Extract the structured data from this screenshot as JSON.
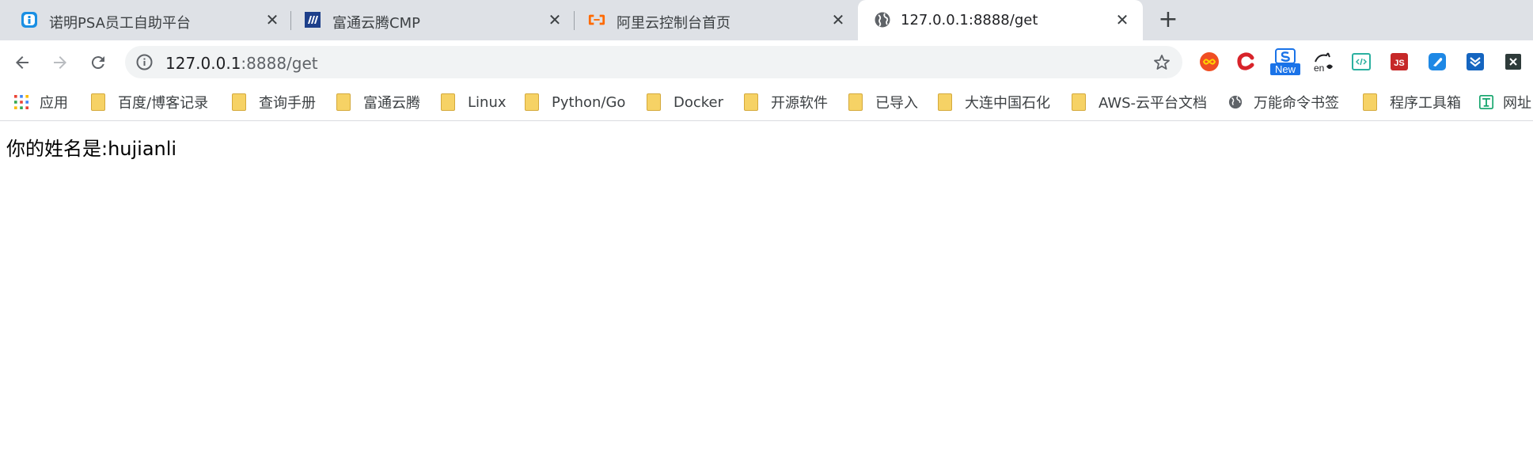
{
  "tabs": [
    {
      "title": "诺明PSA员工自助平台",
      "close": "✕"
    },
    {
      "title": "富通云腾CMP",
      "close": "✕"
    },
    {
      "title": "阿里云控制台首页",
      "close": "✕"
    },
    {
      "title": "127.0.0.1:8888/get",
      "close": "✕"
    }
  ],
  "new_tab": "+",
  "address": {
    "host": "127.0.0.1",
    "rest": ":8888/get"
  },
  "extensions": {
    "new_badge": "New",
    "js_label": "JS",
    "en_label": "en"
  },
  "bookmarks": [
    {
      "label": "应用",
      "icon": "apps-grid-icon"
    },
    {
      "label": "百度/博客记录",
      "icon": "folder-icon"
    },
    {
      "label": "查询手册",
      "icon": "folder-icon"
    },
    {
      "label": "富通云腾",
      "icon": "folder-icon"
    },
    {
      "label": "Linux",
      "icon": "folder-icon"
    },
    {
      "label": "Python/Go",
      "icon": "folder-icon"
    },
    {
      "label": "Docker",
      "icon": "folder-icon"
    },
    {
      "label": "开源软件",
      "icon": "folder-icon"
    },
    {
      "label": "已导入",
      "icon": "folder-icon"
    },
    {
      "label": "大连中国石化",
      "icon": "folder-icon"
    },
    {
      "label": "AWS-云平台文档",
      "icon": "folder-icon"
    },
    {
      "label": "万能命令书签",
      "icon": "globe-icon"
    },
    {
      "label": "程序工具箱",
      "icon": "folder-icon"
    },
    {
      "label": "网址",
      "icon": "t-icon"
    }
  ],
  "page": {
    "text": "你的姓名是:hujianli"
  },
  "colors": {
    "tabstrip": "#dee1e6",
    "omnibox": "#f1f3f4",
    "folder": "#f6d265",
    "aliyun": "#ff6a00"
  }
}
